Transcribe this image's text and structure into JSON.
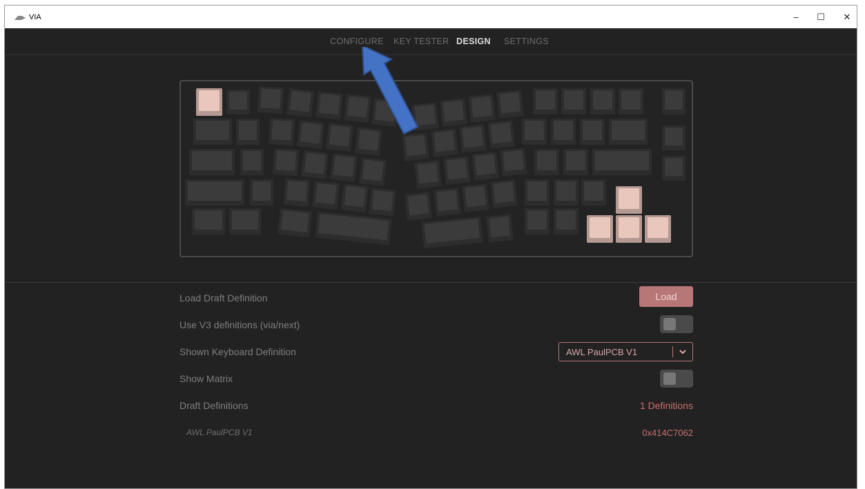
{
  "window": {
    "title": "VIA",
    "controls": {
      "minimize": "–",
      "maximize": "☐",
      "close": "✕"
    }
  },
  "nav": {
    "tabs": [
      {
        "label": "CONFIGURE",
        "active": false
      },
      {
        "label": "KEY TESTER",
        "active": false
      },
      {
        "label": "DESIGN",
        "active": true
      },
      {
        "label": "SETTINGS",
        "active": false
      }
    ]
  },
  "annotation": {
    "icon": "blue-arrow-icon",
    "color": "#4472c4"
  },
  "keyboard": {
    "key_color": "#3b3b3b",
    "highlight_color": "#eac7bd",
    "highlight_border": "#b49a92"
  },
  "design": {
    "load_draft": {
      "label": "Load Draft Definition",
      "button": "Load"
    },
    "use_v3": {
      "label": "Use V3 definitions (via/next)",
      "enabled": false
    },
    "shown_definition": {
      "label": "Shown Keyboard Definition",
      "selected": "AWL PaulPCB V1"
    },
    "show_matrix": {
      "label": "Show Matrix",
      "enabled": false
    },
    "draft_definitions": {
      "label": "Draft Definitions",
      "count": "1 Definitions"
    },
    "draft_items": [
      {
        "name": "AWL PaulPCB V1",
        "id": "0x414C7062"
      }
    ]
  },
  "colors": {
    "accent": "#b87777",
    "accent_text": "#c9706f",
    "background": "#222222"
  }
}
